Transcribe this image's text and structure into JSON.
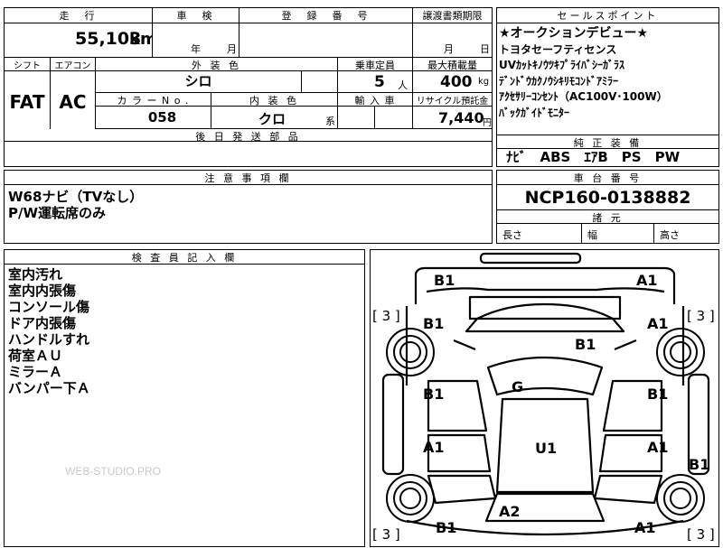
{
  "header": {
    "mileage_label": "走　行",
    "inspection_label": "車　検",
    "registration_label": "登　録　番　号",
    "transfer_label": "譲渡書類期限",
    "selling_label": "セールスポイント"
  },
  "values": {
    "mileage": "55,103",
    "mileage_unit": "km",
    "year_label": "年",
    "month_label": "月",
    "transfer_month": "月",
    "transfer_day": "日"
  },
  "spec": {
    "shift_label": "シフト",
    "aircon_label": "エアコン",
    "exterior_label": "外 装 色",
    "seats_label": "乗車定員",
    "load_label": "最大積載量",
    "shift": "FAT",
    "aircon": "AC",
    "exterior_color": "シロ",
    "seats": "5",
    "seats_unit": "人",
    "load": "400",
    "load_unit": "kg",
    "color_no_label": "カ ラ ー N o .",
    "interior_label": "内 装 色",
    "import_label": "輸 入 車",
    "recycle_label": "リサイクル預託金",
    "color_no": "058",
    "interior_color": "クロ",
    "interior_unit": "系",
    "recycle": "7,440",
    "recycle_unit": "円",
    "postparts_label": "後 日 発 送 部 品"
  },
  "selling_points": [
    "★オークションデビュー★",
    "トヨタセーフティセンス",
    "UVｶｯﾄｷﾉｳﾂｷﾌﾟﾗｲﾊﾞｼｰｶﾞﾗｽ",
    "ﾃﾞﾝﾄﾞｳｶｸﾉｳｼｷﾘﾓｺﾝﾄﾞｱﾐﾗｰ",
    "ｱｸｾｻﾘｰｺﾝｾﾝﾄ（AC100V･100W）",
    "ﾊﾞｯｸｶﾞｲﾄﾞﾓﾆﾀｰ"
  ],
  "equipment": {
    "label": "純 正 装 備",
    "value": "ﾅﾋﾞ　ABS　ｴｱB　PS　PW"
  },
  "notes": {
    "label": "注 意 事 項 欄",
    "lines": [
      "W68ナビ（TVなし）",
      "P/W運転席のみ"
    ]
  },
  "chassis": {
    "label": "車 台 番 号",
    "value": "NCP160-0138882",
    "dims_label": "諸 元",
    "length_label": "長さ",
    "width_label": "幅",
    "height_label": "高さ"
  },
  "inspector": {
    "label": "検 査 員 記 入 欄",
    "lines": [
      "室内汚れ",
      "室内内張傷",
      "コンソール傷",
      "ドア内張傷",
      "ハンドルすれ",
      "荷室ＡＵ",
      "ミラーＡ",
      "バンパー下Ａ"
    ]
  },
  "diagram": {
    "marks": {
      "front_left": "B1",
      "front_right": "A1",
      "fender_left": "B1",
      "fender_right": "A1",
      "hood": "B1",
      "front_door_left": "B1",
      "front_door_right": "B1",
      "glass": "G",
      "rear_door_left": "A1",
      "rear_door_right": "A1",
      "roof": "U1",
      "rear_side_right": "B1",
      "rear_left": "B1",
      "trunk": "A2",
      "rear_right": "A1"
    },
    "tire_tl": "[ 3 ]",
    "tire_tr": "[ 3 ]",
    "tire_bl": "[ 3 ]",
    "tire_br": "[ 3 ]"
  },
  "watermark": "WEB-STUDIO.PRO"
}
